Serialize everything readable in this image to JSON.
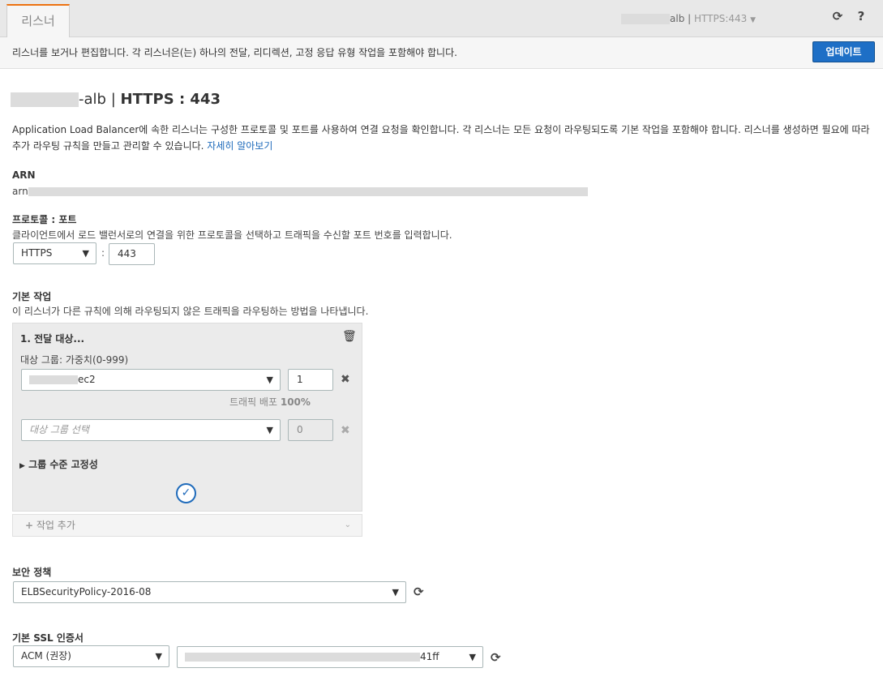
{
  "tab": {
    "label": "리스너"
  },
  "top_bar": {
    "lb_suffix": "alb |",
    "listener": "HTTPS:443",
    "refresh_icon": "refresh-icon",
    "help_icon": "help-icon"
  },
  "info_bar": {
    "message": "리스너를 보거나 편집합니다. 각 리스너은(는) 하나의 전달, 리디렉션, 고정 응답 유형 작업을 포함해야 합니다.",
    "update_button": "업데이트"
  },
  "header": {
    "lb_suffix": "-alb",
    "separator": "|",
    "protocol_port": "HTTPS : 443"
  },
  "description": {
    "text": "Application Load Balancer에 속한 리스너는 구성한 프로토콜 및 포트를 사용하여 연결 요청을 확인합니다. 각 리스너는 모든 요청이 라우팅되도록 기본 작업을 포함해야 합니다. 리스너를 생성하면 필요에 따라 추가 라우팅 규칙을 만들고 관리할 수 있습니다.",
    "learn_more": "자세히 알아보기"
  },
  "arn": {
    "label": "ARN",
    "prefix": "arn"
  },
  "protocol_port": {
    "label": "프로토콜 : 포트",
    "help": "클라이언트에서 로드 밸런서로의 연결을 위한 프로토콜을 선택하고 트래픽을 수신할 포트 번호를 입력합니다.",
    "protocol": "HTTPS",
    "colon": ":",
    "port": "443"
  },
  "default_action": {
    "label": "기본 작업",
    "help": "이 리스너가 다른 규칙에 의해 라우팅되지 않은 트래픽을 라우팅하는 방법을 나타냅니다.",
    "action_title": "1. 전달 대상...",
    "target_group_label": "대상 그룹: 가중치(0-999)",
    "target_group_suffix": "ec2",
    "weight": "1",
    "traffic_label": "트래픽 배포",
    "traffic_value": "100%",
    "select_placeholder": "대상 그룹 선택",
    "weight2": "0",
    "stickiness": "그룹 수준 고정성",
    "add_action": "작업 추가"
  },
  "security_policy": {
    "label": "보안 정책",
    "value": "ELBSecurityPolicy-2016-08"
  },
  "ssl_cert": {
    "label": "기본 SSL 인증서",
    "source": "ACM (권장)",
    "cert_suffix": "41ff"
  },
  "colors": {
    "primary": "#1e6fc6",
    "tab_accent": "#ec7211",
    "link": "#1f6bbb"
  }
}
